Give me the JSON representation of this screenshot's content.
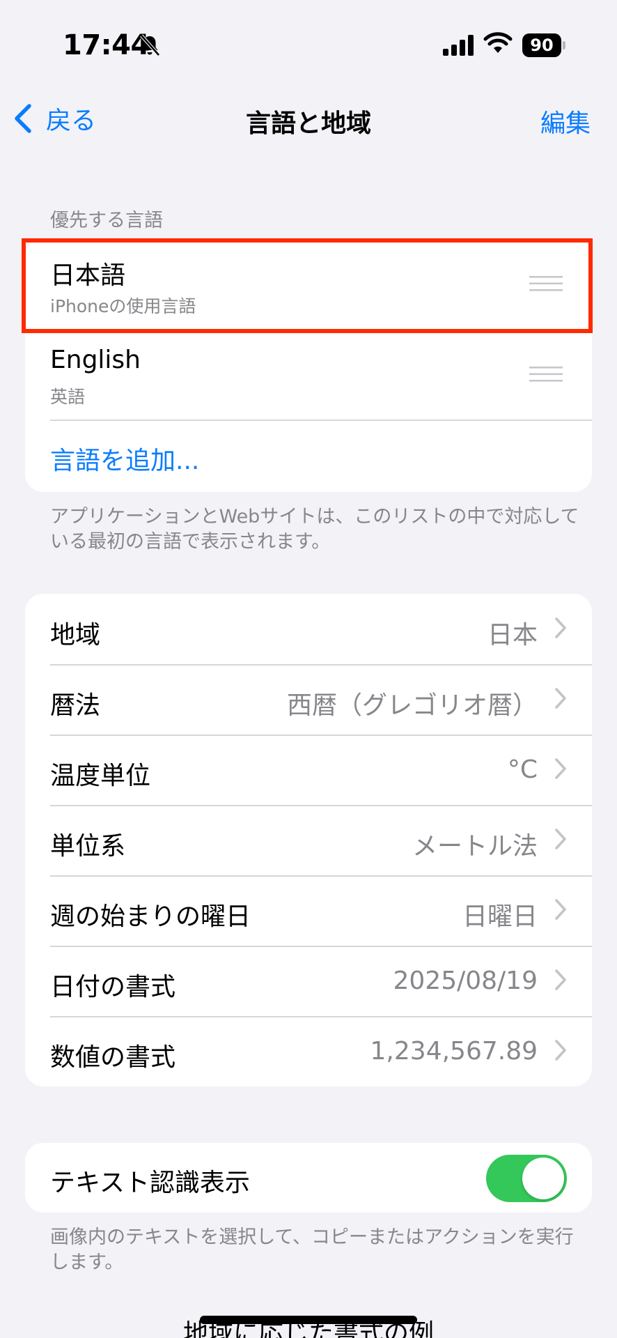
{
  "status_bar": {
    "time": "17:44",
    "battery_level": "90"
  },
  "nav": {
    "back_label": "戻る",
    "title": "言語と地域",
    "edit_label": "編集"
  },
  "preferred_languages": {
    "header": "優先する言語",
    "items": [
      {
        "name": "日本語",
        "subtitle": "iPhoneの使用言語"
      },
      {
        "name": "English",
        "subtitle": "英語"
      }
    ],
    "add_label": "言語を追加...",
    "footer": "アプリケーションとWebサイトは、このリストの中で対応している最初の言語で表示されます。"
  },
  "region_settings": {
    "rows": [
      {
        "label": "地域",
        "value": "日本"
      },
      {
        "label": "暦法",
        "value": "西暦（グレゴリオ暦）"
      },
      {
        "label": "温度単位",
        "value": "°C"
      },
      {
        "label": "単位系",
        "value": "メートル法"
      },
      {
        "label": "週の始まりの曜日",
        "value": "日曜日"
      },
      {
        "label": "日付の書式",
        "value": "2025/08/19"
      },
      {
        "label": "数値の書式",
        "value": "1,234,567.89"
      }
    ]
  },
  "live_text": {
    "label": "テキスト認識表示",
    "enabled": true,
    "footer": "画像内のテキストを選択して、コピーまたはアクションを実行します。"
  },
  "next_section_header": "地域に応じた書式の例",
  "colors": {
    "accent": "#0a7cff",
    "toggle_on": "#34c759",
    "highlight": "#ff2a00",
    "background": "#f2f2f7"
  }
}
